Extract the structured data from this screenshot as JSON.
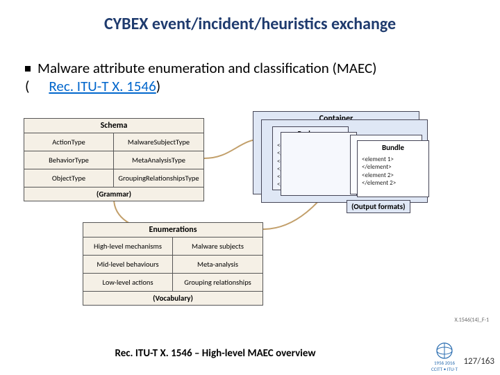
{
  "title": "CYBEX event/incident/heuristics exchange",
  "bullet": {
    "text": "Malware attribute enumeration and classification (MAEC)",
    "link": "Rec. ITU-T X. 1546"
  },
  "schema": {
    "title": "Schema",
    "cells": [
      "ActionType",
      "MalwareSubjectType",
      "BehaviorType",
      "MetaAnalysisType",
      "ObjectType",
      "GroupingRelationshipsType"
    ],
    "label": "(Grammar)"
  },
  "enums": {
    "title": "Enumerations",
    "cells": [
      "High-level mechanisms",
      "Malware subjects",
      "Mid-level behaviours",
      "Meta-analysis",
      "Low-level actions",
      "Grouping relationships"
    ],
    "label": "(Vocabulary)"
  },
  "container": {
    "title": "Container",
    "package": {
      "title": "Package",
      "lines": [
        "<element A>",
        "</element>",
        "<element B>",
        "</element>",
        "<element",
        "</elemen"
      ]
    },
    "bundle": {
      "title": "Bundle",
      "lines": [
        "<element 1>",
        "</element>",
        "<element 2>",
        "</element 2>"
      ]
    },
    "outputs": "(Output formats)"
  },
  "caption": "Rec. ITU-T X. 1546 – High-level MAEC overview",
  "figref": "X.1546(14)_F-1",
  "logo": {
    "top": "1956",
    "bottom": "2016",
    "sub": "CCITT • ITU-T"
  },
  "page": "127/163"
}
